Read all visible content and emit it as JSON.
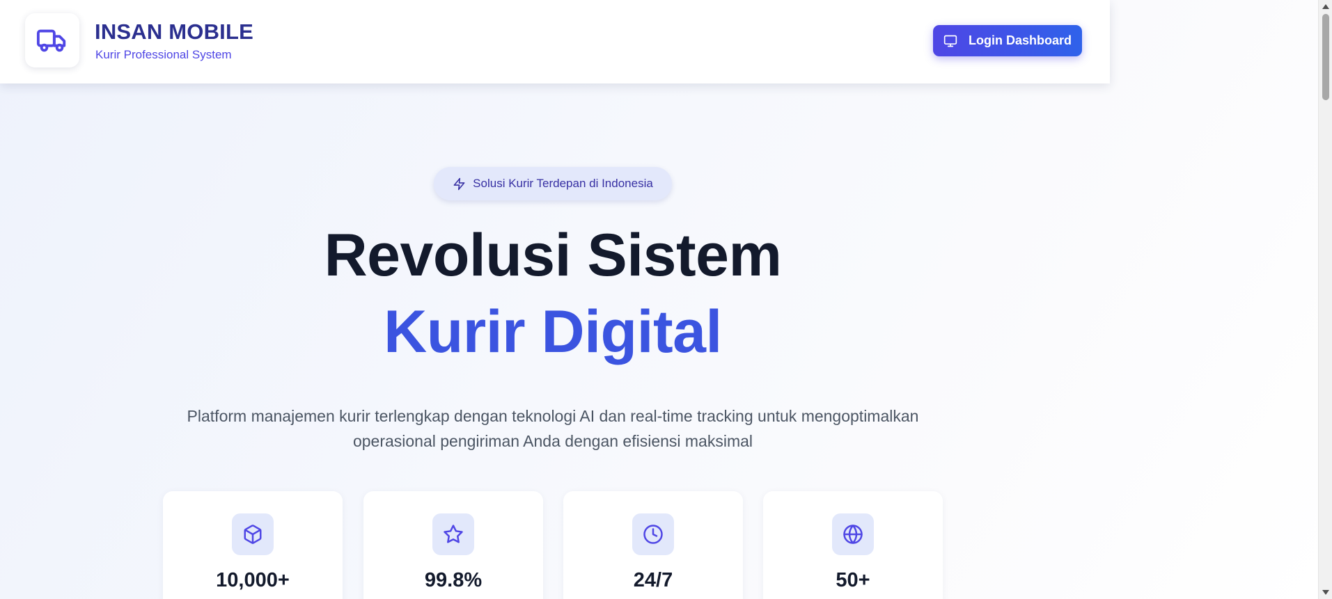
{
  "header": {
    "brand_title": "INSAN MOBILE",
    "brand_subtitle": "Kurir Professional System",
    "logo_icon": "truck-icon",
    "login_label": "Login Dashboard",
    "login_icon": "monitor-icon"
  },
  "hero": {
    "badge_text": "Solusi Kurir Terdepan di Indonesia",
    "badge_icon": "lightning-icon",
    "title_line1": "Revolusi Sistem",
    "title_line2": "Kurir Digital",
    "description": "Platform manajemen kurir terlengkap dengan teknologi AI dan real-time tracking untuk mengoptimalkan operasional pengiriman Anda dengan efisiensi maksimal"
  },
  "stats": [
    {
      "icon": "package-icon",
      "value": "10,000+"
    },
    {
      "icon": "star-icon",
      "value": "99.8%"
    },
    {
      "icon": "clock-icon",
      "value": "24/7"
    },
    {
      "icon": "globe-icon",
      "value": "50+"
    }
  ],
  "colors": {
    "brand": "#2b2f8f",
    "accent": "#4f46e5",
    "accent_blue": "#3b54e0",
    "heading": "#131a2c",
    "badge_bg": "#e3e8fb"
  }
}
